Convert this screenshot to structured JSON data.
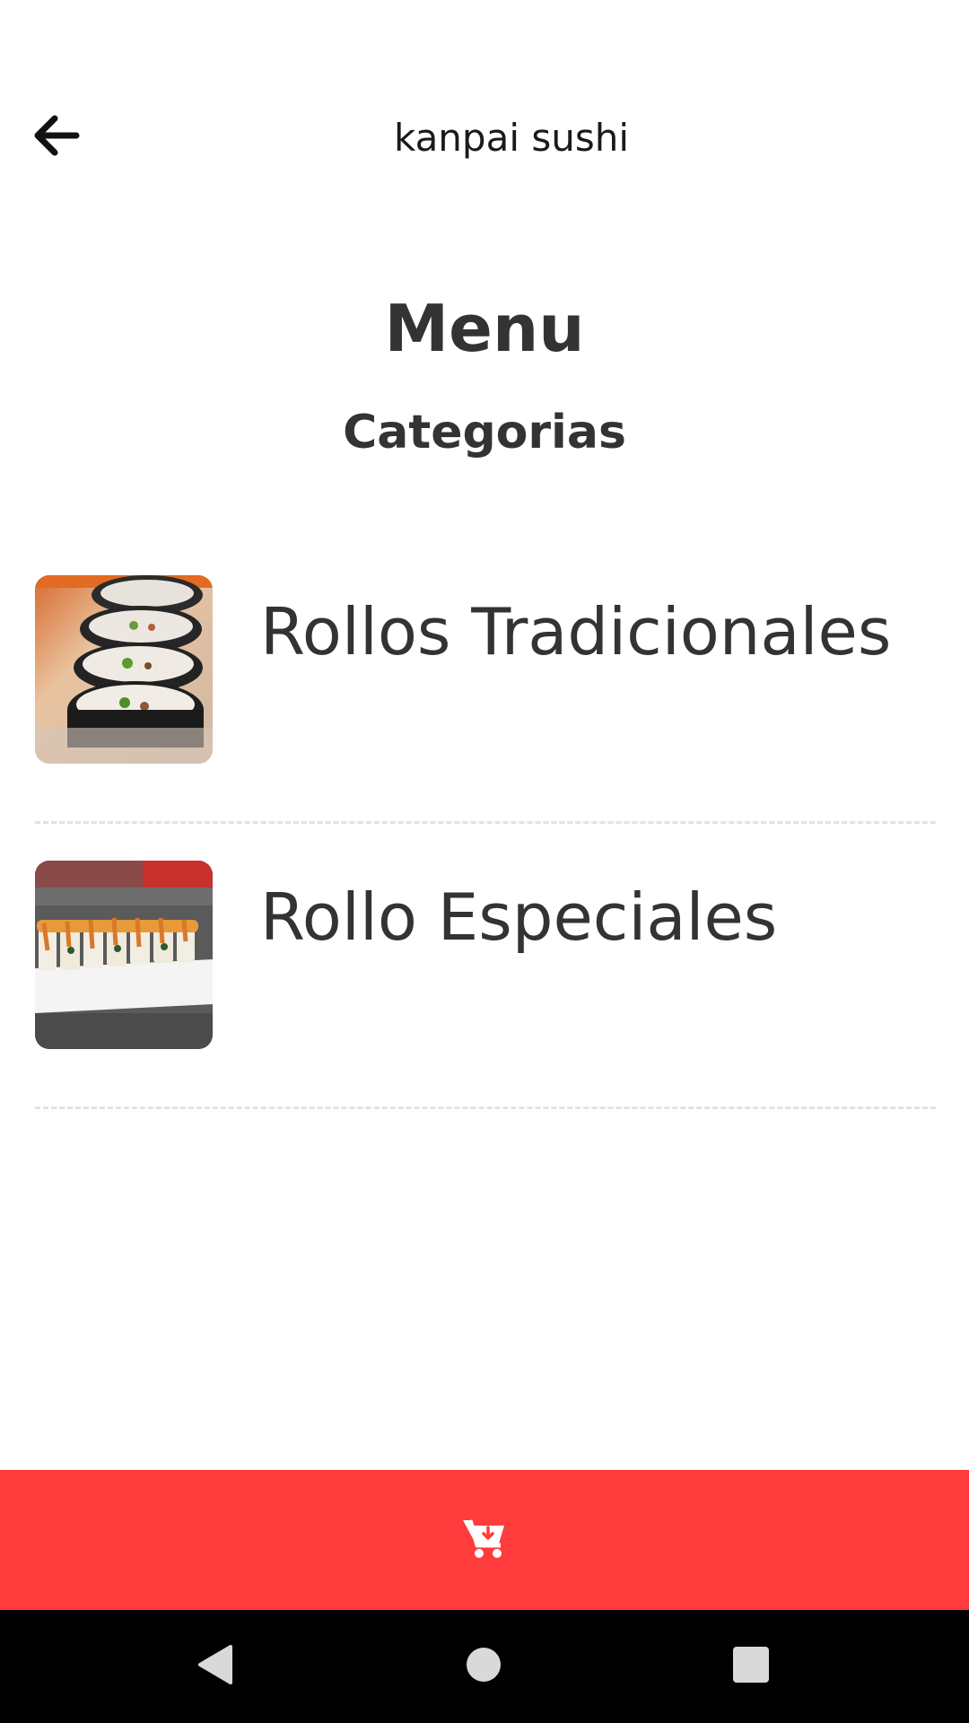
{
  "app_bar": {
    "title": "kanpai sushi",
    "back_icon": "arrow-left-icon"
  },
  "page": {
    "heading": "Menu",
    "subheading": "Categorias"
  },
  "categories": [
    {
      "label": "Rollos Tradicionales",
      "image": "maki-rolls-photo"
    },
    {
      "label": "Rollo Especiales",
      "image": "special-rolls-photo"
    }
  ],
  "cart_bar": {
    "icon": "cart-download-icon",
    "color": "#ff3b3b"
  },
  "nav_bar": {
    "back_icon": "triangle-back-icon",
    "home_icon": "circle-home-icon",
    "recents_icon": "square-recents-icon"
  }
}
